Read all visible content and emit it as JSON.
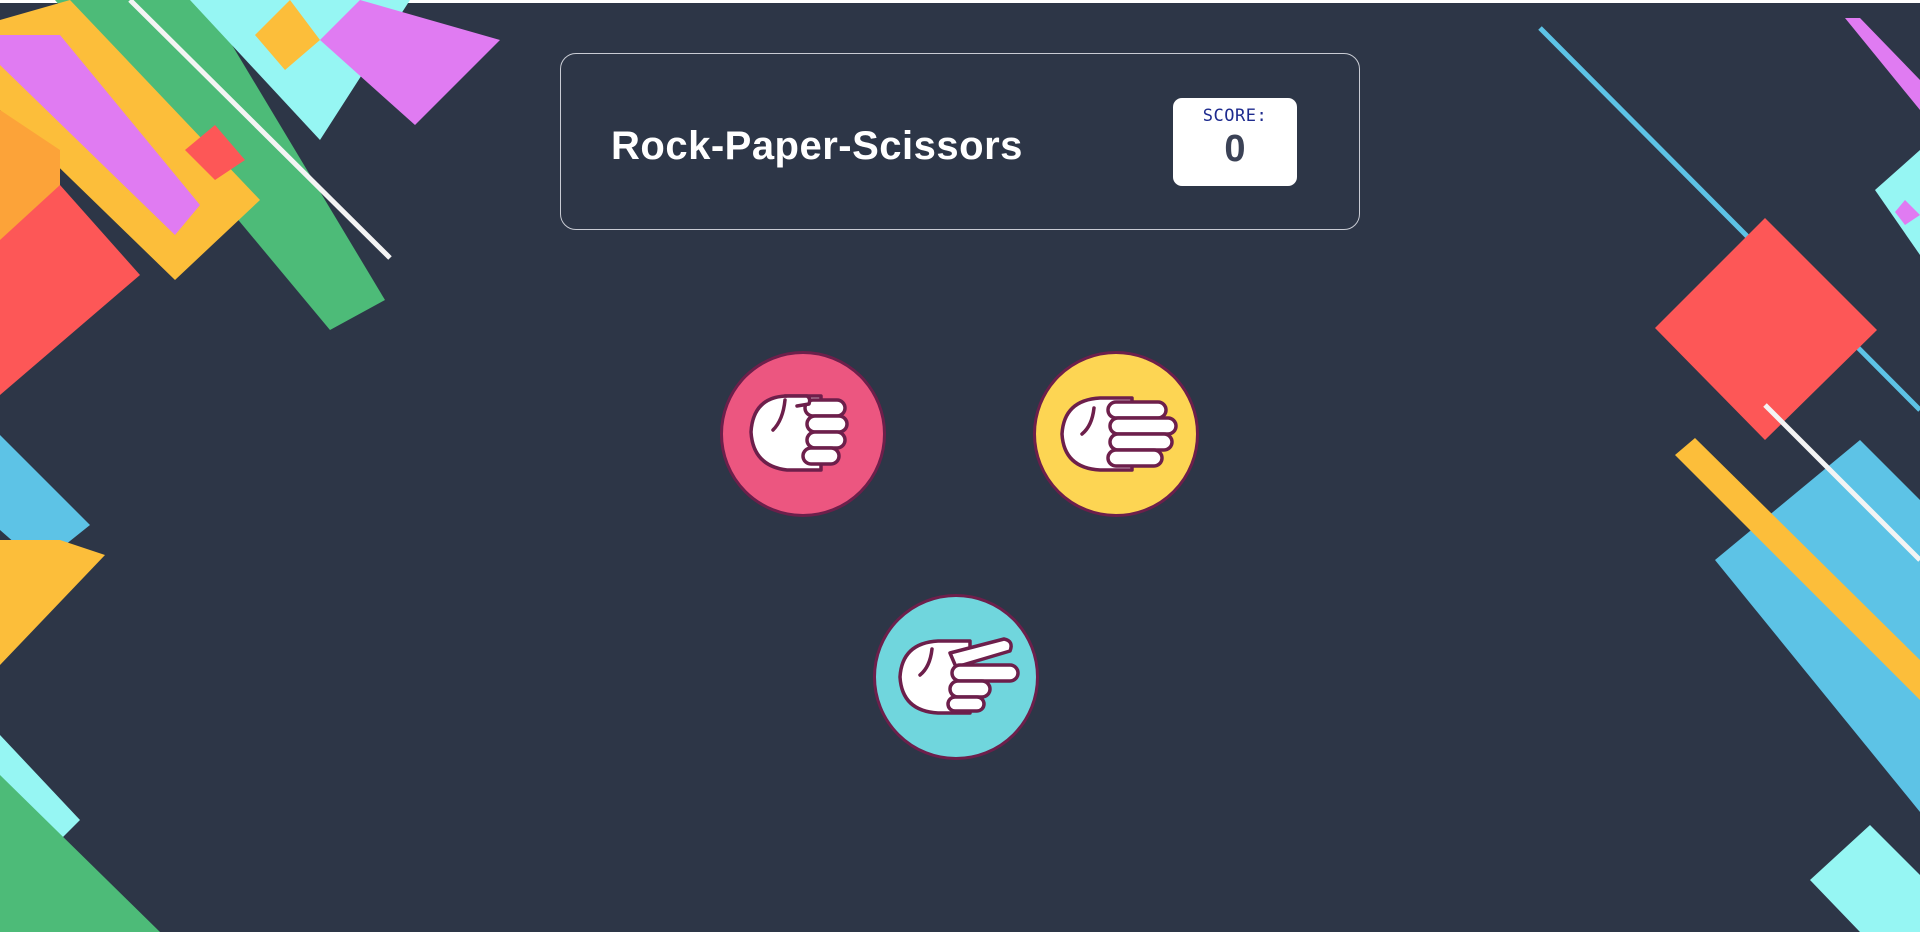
{
  "game": {
    "title": "Rock-Paper-Scissors",
    "score_label": "SCORE:",
    "score_value": "0"
  },
  "choices": [
    {
      "name": "rock",
      "icon": "rock-fist-icon",
      "color": "#ec5680"
    },
    {
      "name": "paper",
      "icon": "paper-hand-icon",
      "color": "#fdd553"
    },
    {
      "name": "scissors",
      "icon": "scissors-hand-icon",
      "color": "#70d6dd"
    }
  ],
  "colors": {
    "background": "#2d3647",
    "header_border": "#c9ccd4",
    "score_label": "#1e2b8e",
    "score_value": "#3b4256",
    "icon_outline": "#6d1f4b"
  }
}
